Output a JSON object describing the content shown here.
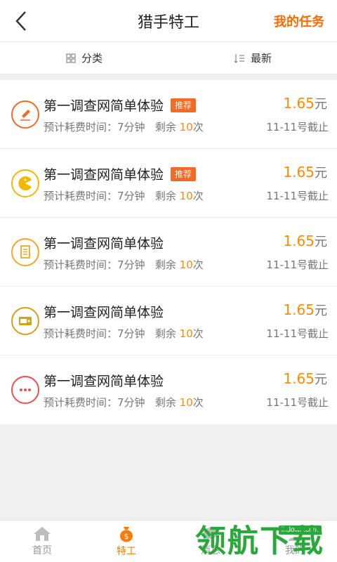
{
  "header": {
    "title": "猎手特工",
    "right_action": "我的任务",
    "accent": "#ff6a00"
  },
  "filters": [
    {
      "label": "分类",
      "icon": "grid-icon"
    },
    {
      "label": "最新",
      "icon": "sort-icon"
    }
  ],
  "tasks": [
    {
      "title": "第一调查网简单体验",
      "badge": "推荐",
      "time_label": "预计耗费时间：",
      "time_value": "7分钟",
      "remain_label": "剩余",
      "remain_count": "10",
      "remain_unit": "次",
      "price": "1.65",
      "unit": "元",
      "deadline": "11-11号截止",
      "icon": "pencil-icon",
      "icon_color": "#f26a26"
    },
    {
      "title": "第一调查网简单体验",
      "badge": "推荐",
      "time_label": "预计耗费时间：",
      "time_value": "7分钟",
      "remain_label": "剩余",
      "remain_count": "10",
      "remain_unit": "次",
      "price": "1.65",
      "unit": "元",
      "deadline": "11-11号截止",
      "icon": "pacman-icon",
      "icon_color": "#f5b800"
    },
    {
      "title": "第一调查网简单体验",
      "badge": "",
      "time_label": "预计耗费时间：",
      "time_value": "7分钟",
      "remain_label": "剩余",
      "remain_count": "10",
      "remain_unit": "次",
      "price": "1.65",
      "unit": "元",
      "deadline": "11-11号截止",
      "icon": "document-icon",
      "icon_color": "#f5a623"
    },
    {
      "title": "第一调查网简单体验",
      "badge": "",
      "time_label": "预计耗费时间：",
      "time_value": "7分钟",
      "remain_label": "剩余",
      "remain_count": "10",
      "remain_unit": "次",
      "price": "1.65",
      "unit": "元",
      "deadline": "11-11号截止",
      "icon": "wallet-icon",
      "icon_color": "#d4a017"
    },
    {
      "title": "第一调查网简单体验",
      "badge": "",
      "time_label": "预计耗费时间：",
      "time_value": "7分钟",
      "remain_label": "剩余",
      "remain_count": "10",
      "remain_unit": "次",
      "price": "1.65",
      "unit": "元",
      "deadline": "11-11号截止",
      "icon": "more-icon",
      "icon_color": "#f04e4e"
    }
  ],
  "tabbar": [
    {
      "label": "首页",
      "icon": "home-icon",
      "active": false
    },
    {
      "label": "特工",
      "icon": "money-bag-icon",
      "active": true
    },
    {
      "label": "消息",
      "icon": "message-icon",
      "active": false
    },
    {
      "label": "我的",
      "icon": "user-icon",
      "active": false
    }
  ],
  "watermark": {
    "brand": "领航下载",
    "site": "lhdown.com"
  }
}
